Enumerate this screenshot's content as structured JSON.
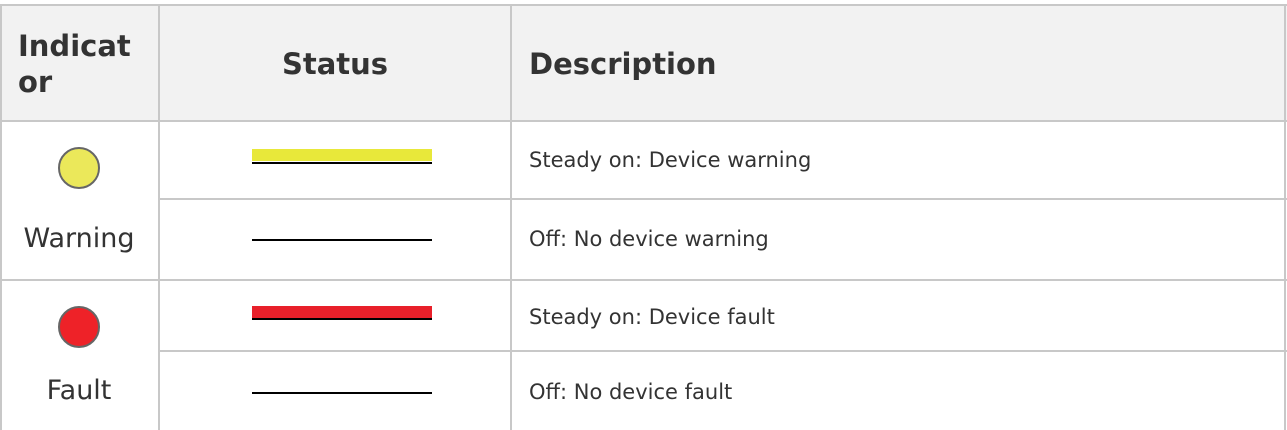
{
  "table": {
    "headers": {
      "indicator": "Indicator",
      "status": "Status",
      "description": "Description"
    },
    "groups": [
      {
        "label": "Warning",
        "led_color": "#EBE85A",
        "rows": [
          {
            "status": "steady-on",
            "bar_color": "#E8E83A",
            "description": "Steady on: Device warning"
          },
          {
            "status": "off",
            "description": "Off: No device warning"
          }
        ]
      },
      {
        "label": "Fault",
        "led_color": "#EE2228",
        "rows": [
          {
            "status": "steady-on",
            "bar_color": "#E8202A",
            "description": "Steady on: Device fault"
          },
          {
            "status": "off",
            "description": "Off: No device fault"
          }
        ]
      }
    ]
  }
}
